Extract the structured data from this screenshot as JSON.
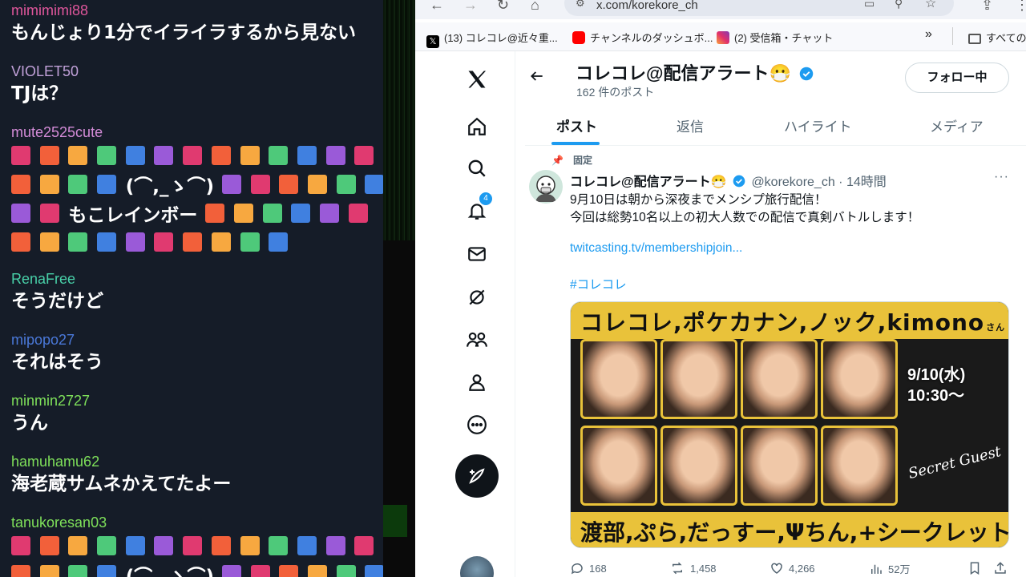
{
  "chat": {
    "messages": [
      {
        "user": "mimimimi88",
        "color": "#e0569c",
        "text": "もんじょり1分でイライラするから見ない"
      },
      {
        "user": "VIOLET50",
        "color": "#c0a0d8",
        "text": "TJは？"
      },
      {
        "user": "mute2525cute",
        "color": "#d48cd8",
        "emote_lines": [
          {
            "pre": 13,
            "text": "",
            "post": 0
          },
          {
            "pre": 4,
            "text": "(⌒,_ゝ⌒)",
            "post": 6
          },
          {
            "pre": 2,
            "text": "もこレインボー",
            "post": 6
          },
          {
            "pre": 10,
            "text": "",
            "post": 0
          }
        ]
      },
      {
        "user": "RenaFree",
        "color": "#48d0a8",
        "text": "そうだけど"
      },
      {
        "user": "mipopo27",
        "color": "#4a78d8",
        "text": "それはそう"
      },
      {
        "user": "minmin2727",
        "color": "#7ee05a",
        "text": "うん"
      },
      {
        "user": "hamuhamu62",
        "color": "#7ee05a",
        "text": "海老蔵サムネかえてたよー"
      },
      {
        "user": "tanukoresan03",
        "color": "#7ee05a",
        "emote_lines": [
          {
            "pre": 13,
            "text": "",
            "post": 0
          },
          {
            "pre": 4,
            "text": "(⌒,_ゝ⌒)",
            "post": 6
          }
        ]
      }
    ],
    "emote_colors": [
      "#e03a70",
      "#f2603a",
      "#f7a840",
      "#4ec97a",
      "#4080e0",
      "#9a5ad8"
    ]
  },
  "browser": {
    "url": "x.com/korekore_ch",
    "bookmarks": [
      {
        "label": "(13) コレコレ@近々重...",
        "icon": "x-icon"
      },
      {
        "label": "チャンネルのダッシュボ...",
        "icon": "youtube-icon"
      },
      {
        "label": "(2) 受信箱・チャット",
        "icon": "instagram-icon"
      },
      {
        "label": "すべての",
        "icon": "folder-icon"
      }
    ],
    "more_bookmarks": "»"
  },
  "xnav": {
    "notif_count": "4"
  },
  "profile": {
    "name": "コレコレ@配信アラート😷",
    "post_count": "162 件のポスト",
    "follow_label": "フォロー中"
  },
  "tabs": [
    "ポスト",
    "返信",
    "ハイライト",
    "メディア"
  ],
  "tweet": {
    "pinned_label": "固定",
    "author": "コレコレ@配信アラート😷",
    "handle_time": "@korekore_ch · 14時間",
    "more": "···",
    "line1": "9月10日は朝から深夜までメンシプ旅行配信！",
    "line2": "今回は総勢10名以上の初大人数での配信で真剣バトルします！",
    "link": "twitcasting.tv/membershipjoin...",
    "hashtag": "#コレコレ",
    "media": {
      "title": "コレコレ,ポケカナン,ノック,kimono",
      "title_small": "さん",
      "date": "9/10(水)",
      "time": "10:30〜",
      "guest": "Secret Guest",
      "footer": "渡部,ぷら,だっすー,Ψちん,+シークレット"
    },
    "stats": {
      "replies": "168",
      "reposts": "1,458",
      "likes": "4,266",
      "views": "52万"
    }
  }
}
